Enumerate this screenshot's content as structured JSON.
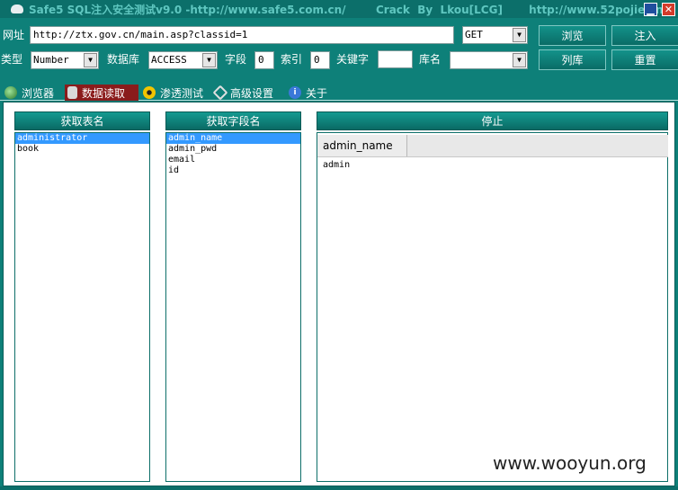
{
  "window": {
    "title": "Safe5 SQL注入安全测试v9.0 -http://www.safe5.com.cn/        Crack  By  Lkou[LCG]       http://www.52pojie.cn",
    "min_glyph": "▁",
    "close_glyph": "✕"
  },
  "toolbar": {
    "url_label": "网址",
    "url_value": "http://ztx.gov.cn/main.asp?classid=1",
    "method": "GET",
    "browse_label": "浏览",
    "inject_label": "注入",
    "type_label": "类型",
    "type_value": "Number",
    "db_label": "数据库",
    "db_value": "ACCESS",
    "field_label": "字段",
    "field_value": "0",
    "index_label": "索引",
    "index_value": "0",
    "keyword_label": "关键字",
    "keyword_value": "",
    "dbname_label": "库名",
    "dbname_value": "",
    "list_db_label": "列库",
    "reset_label": "重置"
  },
  "tabs": [
    {
      "label": "浏览器",
      "icon": "globe-icon"
    },
    {
      "label": "数据读取",
      "icon": "database-icon"
    },
    {
      "label": "渗透测试",
      "icon": "radiation-icon"
    },
    {
      "label": "高级设置",
      "icon": "tools-icon"
    },
    {
      "label": "关于",
      "icon": "info-icon"
    }
  ],
  "panels": {
    "tables_header": "获取表名",
    "tables": [
      "administrator",
      "book"
    ],
    "fields_header": "获取字段名",
    "fields": [
      "admin_name",
      "admin_pwd",
      "email",
      "id"
    ],
    "stop_header": "停止",
    "result_column": "admin_name",
    "result_rows": [
      "admin"
    ]
  },
  "watermark": "www.wooyun.org",
  "colors": {
    "background": "#0e8079",
    "active_tab": "#8a1c1c",
    "selection": "#3399ff"
  }
}
